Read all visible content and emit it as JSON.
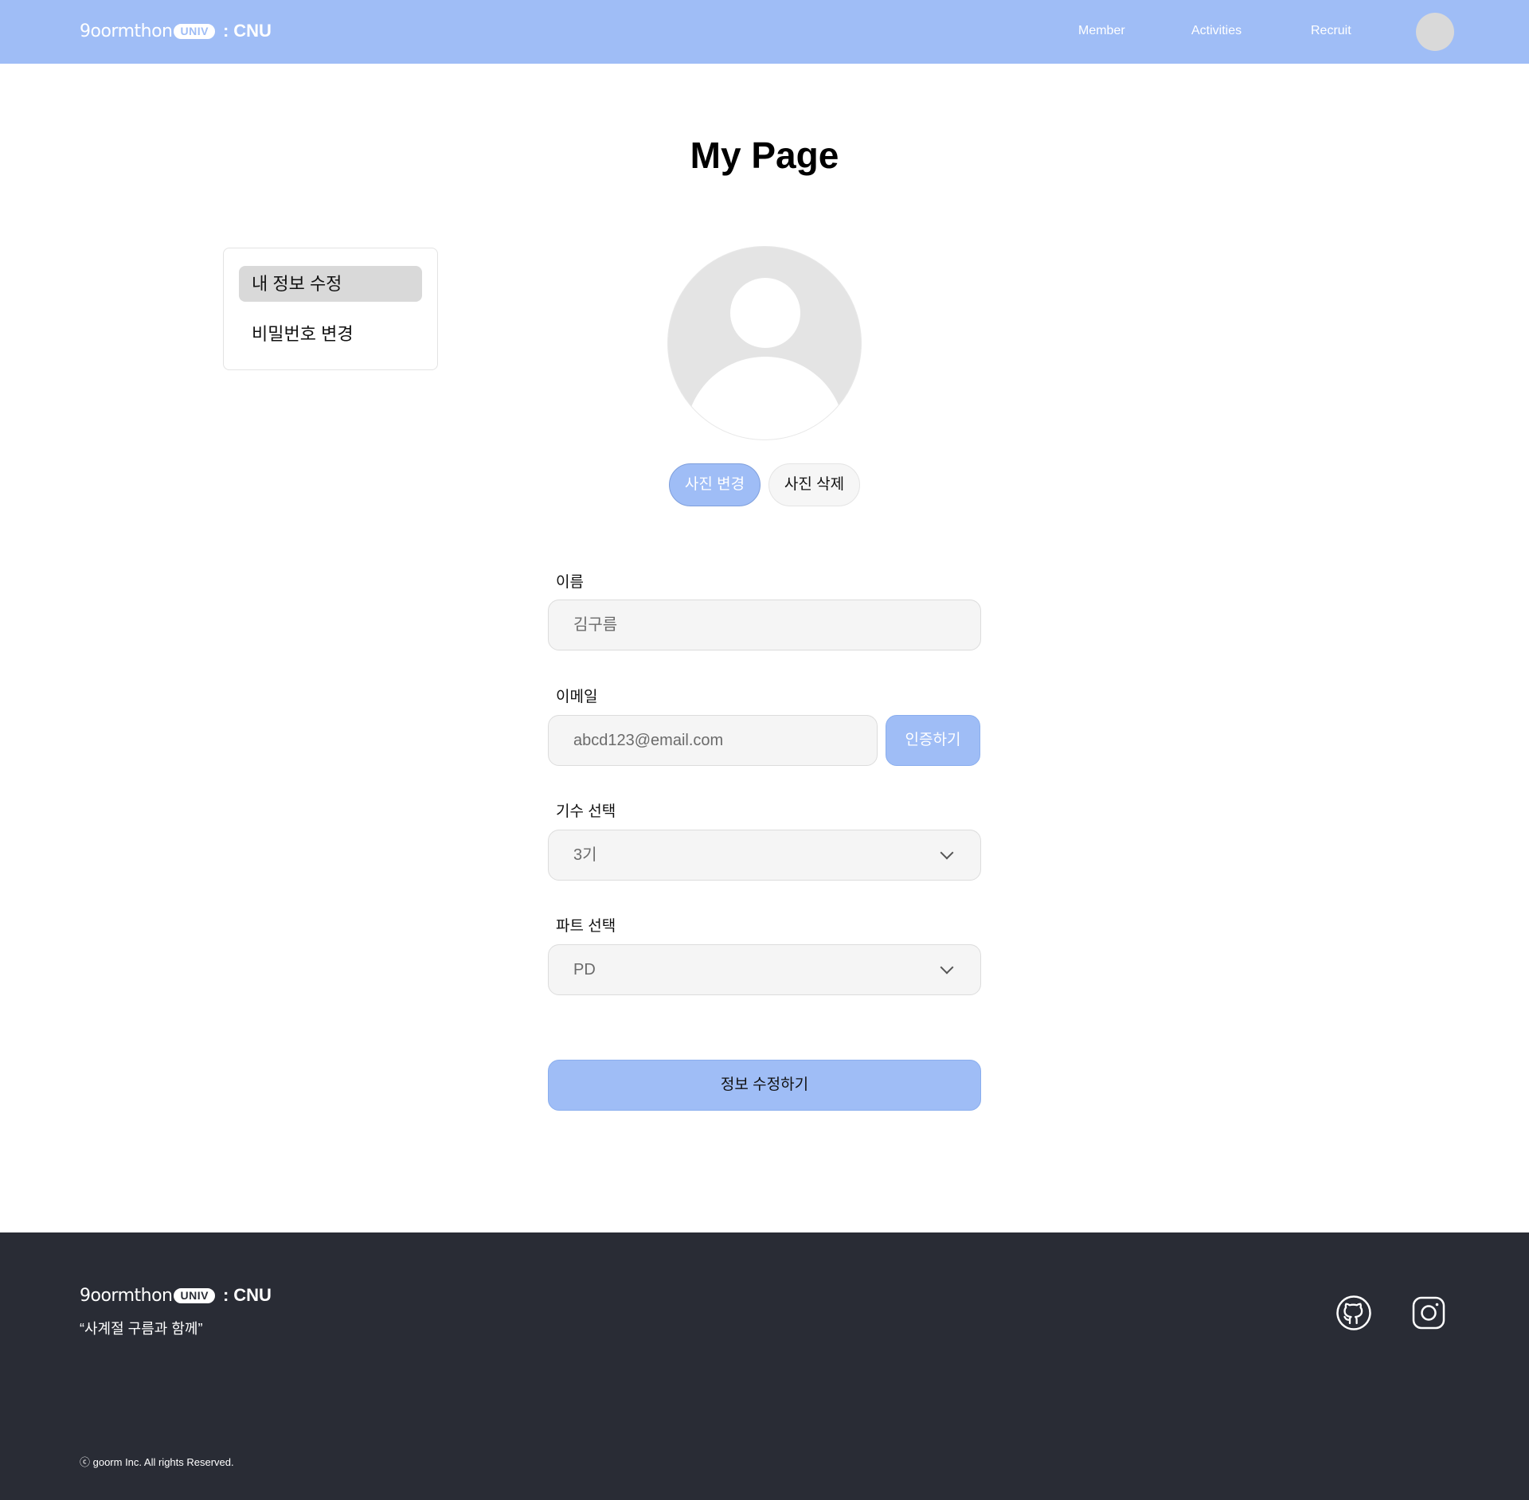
{
  "header": {
    "logo": {
      "brand": "9oormthon",
      "badge": "UNIV",
      "separator": ":",
      "school": "CNU"
    },
    "nav": [
      "Member",
      "Activities",
      "Recruit"
    ]
  },
  "page_title": "My Page",
  "side_menu": {
    "items": [
      {
        "label": "내 정보 수정",
        "active": true
      },
      {
        "label": "비밀번호 변경",
        "active": false
      }
    ]
  },
  "profile": {
    "change_photo": "사진 변경",
    "delete_photo": "사진 삭제"
  },
  "form": {
    "name_label": "이름",
    "name_value": "김구름",
    "email_label": "이메일",
    "email_value": "abcd123@email.com",
    "verify_label": "인증하기",
    "generation_label": "기수 선택",
    "generation_value": "3기",
    "part_label": "파트 선택",
    "part_value": "PD",
    "submit_label": "정보 수정하기"
  },
  "footer": {
    "logo": {
      "brand": "9oormthon",
      "badge": "UNIV",
      "separator": ":",
      "school": "CNU"
    },
    "slogan": "“사계절 구름과 함께”",
    "copyright": "ⓒ goorm Inc. All rights Reserved.",
    "social": [
      "github-icon",
      "instagram-icon"
    ]
  },
  "colors": {
    "accent": "#9fbdf6",
    "footer_bg": "#292c35",
    "field_bg": "#f5f5f5"
  }
}
